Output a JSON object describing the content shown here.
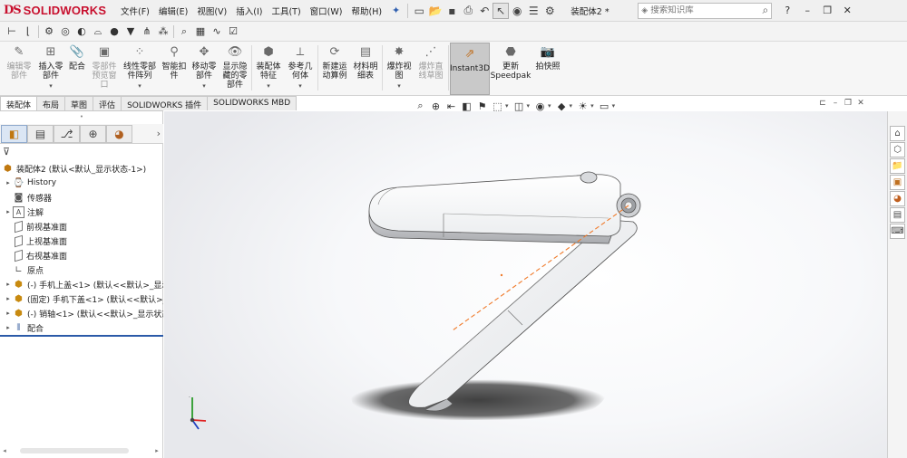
{
  "app": {
    "logo_ds": "DS",
    "logo_name": "SOLIDWORKS"
  },
  "menu": [
    "文件(F)",
    "编辑(E)",
    "视图(V)",
    "插入(I)",
    "工具(T)",
    "窗口(W)",
    "帮助(H)"
  ],
  "document": {
    "title": "装配体2 *"
  },
  "search": {
    "placeholder": "搜索知识库"
  },
  "ribbon": {
    "items": [
      {
        "label": "编辑零\n部件",
        "icon": "edit-component-icon",
        "enabled": false
      },
      {
        "label": "插入零\n部件",
        "icon": "insert-component-icon",
        "enabled": true,
        "dropdown": true
      },
      {
        "label": "配合",
        "icon": "mate-icon",
        "enabled": true
      },
      {
        "label": "零部件\n预览窗\n口",
        "icon": "component-preview-icon",
        "enabled": false
      },
      {
        "label": "线性零部\n件阵列",
        "icon": "linear-pattern-icon",
        "enabled": true,
        "dropdown": true
      },
      {
        "label": "智能扣\n件",
        "icon": "smart-fastener-icon",
        "enabled": true
      },
      {
        "label": "移动零\n部件",
        "icon": "move-component-icon",
        "enabled": true,
        "dropdown": true
      },
      {
        "label": "显示隐\n藏的零\n部件",
        "icon": "show-hidden-icon",
        "enabled": true
      },
      {
        "label": "装配体\n特征",
        "icon": "assembly-feature-icon",
        "enabled": true,
        "dropdown": true
      },
      {
        "label": "参考几\n何体",
        "icon": "reference-geometry-icon",
        "enabled": true,
        "dropdown": true
      },
      {
        "label": "新建运\n动算例",
        "icon": "motion-study-icon",
        "enabled": true
      },
      {
        "label": "材料明\n细表",
        "icon": "bom-icon",
        "enabled": true
      },
      {
        "label": "爆炸视\n图",
        "icon": "exploded-view-icon",
        "enabled": true,
        "dropdown": true
      },
      {
        "label": "爆炸直\n线草图",
        "icon": "explode-line-icon",
        "enabled": false
      },
      {
        "label": "Instant3D",
        "icon": "instant3d-icon",
        "enabled": true,
        "active": true
      },
      {
        "label": "更新\nSpeedpak",
        "icon": "speedpak-icon",
        "enabled": true
      },
      {
        "label": "拍快照",
        "icon": "snapshot-icon",
        "enabled": true
      }
    ]
  },
  "tabs": [
    "装配体",
    "布局",
    "草图",
    "评估",
    "SOLIDWORKS 插件",
    "SOLIDWORKS MBD"
  ],
  "feature_tree": {
    "root": "装配体2  (默认<默认_显示状态-1>)",
    "items": [
      {
        "label": "History",
        "icon": "history-icon",
        "expandable": true
      },
      {
        "label": "传感器",
        "icon": "sensor-icon",
        "expandable": false
      },
      {
        "label": "注解",
        "icon": "annotation-icon",
        "expandable": true
      },
      {
        "label": "前视基准面",
        "icon": "plane-icon",
        "expandable": false
      },
      {
        "label": "上视基准面",
        "icon": "plane-icon",
        "expandable": false
      },
      {
        "label": "右视基准面",
        "icon": "plane-icon",
        "expandable": false
      },
      {
        "label": "原点",
        "icon": "origin-icon",
        "expandable": false
      },
      {
        "label": "(-) 手机上盖<1> (默认<<默认>_显示",
        "icon": "part-icon",
        "expandable": true
      },
      {
        "label": "(固定) 手机下盖<1> (默认<<默认>_",
        "icon": "part-icon",
        "expandable": true
      },
      {
        "label": "(-) 销轴<1> (默认<<默认>_显示状态",
        "icon": "part-icon",
        "expandable": true
      },
      {
        "label": "配合",
        "icon": "mates-folder-icon",
        "expandable": true
      }
    ]
  },
  "colors": {
    "brand": "#c8102e",
    "axis_red": "#e02020",
    "axis_green": "#2a9a2a",
    "axis_blue": "#2040c0",
    "centerline": "#f07a2a"
  }
}
